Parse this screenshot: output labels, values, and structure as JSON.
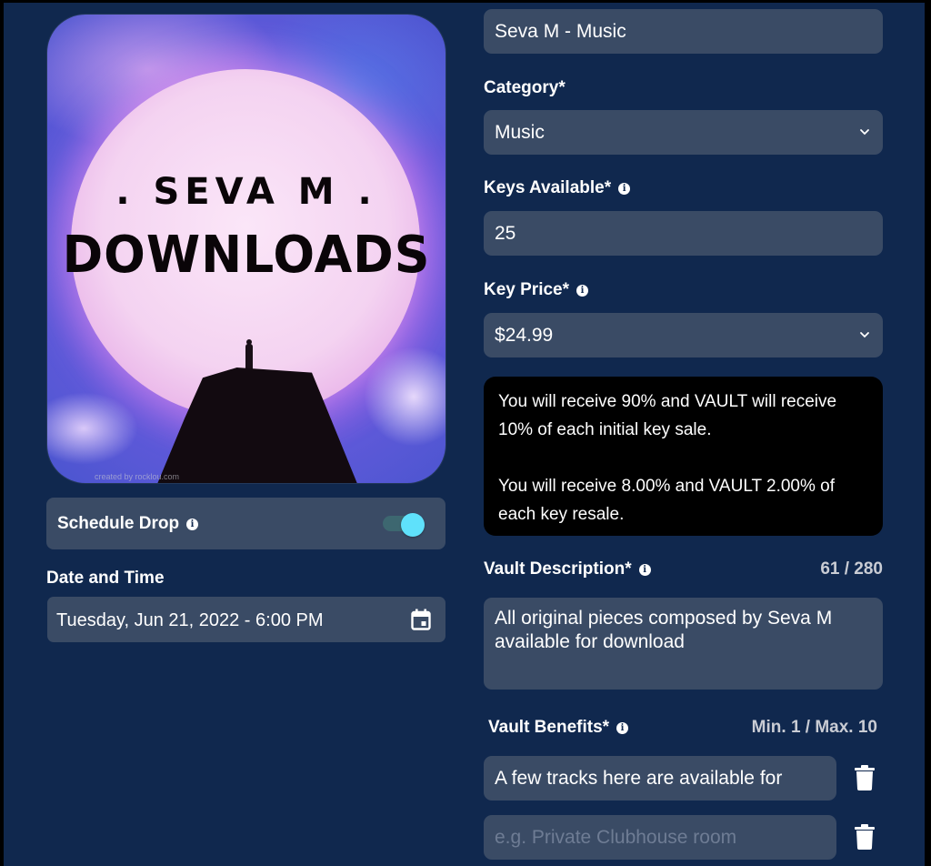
{
  "cover": {
    "title_line1": ". SEVA M .",
    "title_line2": "DOWNLOADS",
    "credit": "created by rocklou.com"
  },
  "schedule": {
    "label": "Schedule Drop",
    "info_icon": "info-icon",
    "enabled": true,
    "toggle_color": "#5fe1fb"
  },
  "datetime": {
    "label": "Date and Time",
    "value": "Tuesday, Jun 21, 2022 - 6:00 PM",
    "icon": "calendar-icon"
  },
  "form": {
    "name_value": "Seva M - Music",
    "category": {
      "label": "Category*",
      "value": "Music"
    },
    "keys_available": {
      "label": "Keys Available*",
      "value": "25"
    },
    "key_price": {
      "label": "Key Price*",
      "value": "$24.99"
    },
    "notice": {
      "line1": "You will receive 90% and VAULT will receive 10% of each initial key sale.",
      "line2": "You will receive 8.00% and VAULT 2.00% of each key resale."
    },
    "description": {
      "label": "Vault Description*",
      "counter": "61 / 280",
      "value": "All original pieces composed by Seva M available for download"
    },
    "benefits": {
      "label": "Vault Benefits*",
      "limits": "Min. 1 / Max. 10",
      "items": [
        {
          "value": "A few tracks here are available for",
          "placeholder": ""
        },
        {
          "value": "",
          "placeholder": "e.g. Private Clubhouse room"
        }
      ]
    }
  },
  "colors": {
    "background": "#10284e",
    "field": "#3a4b65",
    "notice_bg": "#000000",
    "accent": "#5fe1fb"
  }
}
